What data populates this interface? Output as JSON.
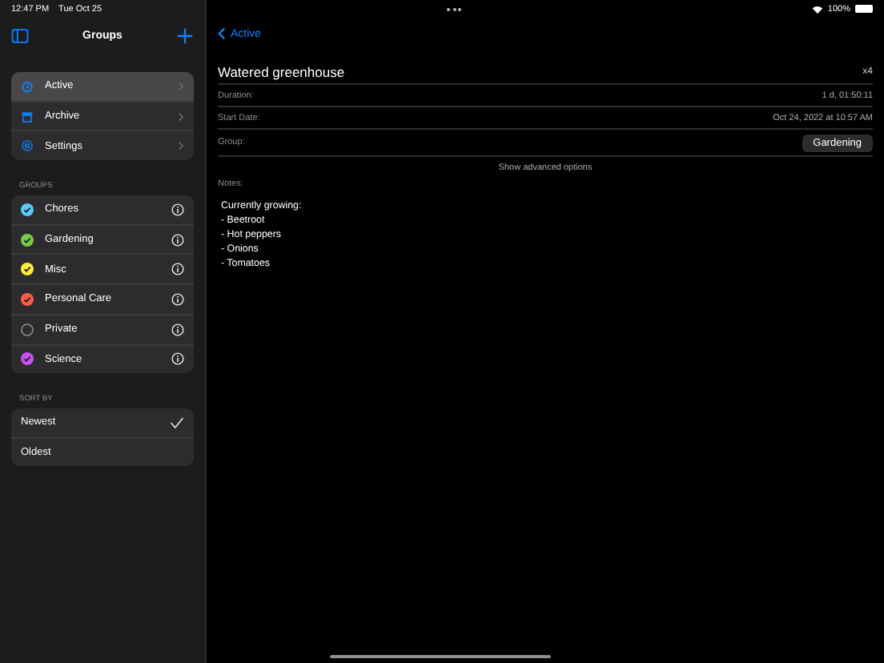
{
  "status_bar": {
    "time": "12:47 PM",
    "date": "Tue Oct 25",
    "battery": "100%"
  },
  "sidebar": {
    "title": "Groups",
    "nav_items": [
      {
        "label": "Active",
        "kind": "timer",
        "selected": true
      },
      {
        "label": "Archive",
        "kind": "archive",
        "selected": false
      },
      {
        "label": "Settings",
        "kind": "settings",
        "selected": false
      }
    ],
    "groups_header": "GROUPS",
    "groups": [
      {
        "label": "Chores",
        "color": "#5ac8fa",
        "checked": true
      },
      {
        "label": "Gardening",
        "color": "#7ac943",
        "checked": true
      },
      {
        "label": "Misc",
        "color": "#ffeb3b",
        "checked": true
      },
      {
        "label": "Personal Care",
        "color": "#ff5a4a",
        "checked": true
      },
      {
        "label": "Private",
        "color": "#8e8e93",
        "checked": false
      },
      {
        "label": "Science",
        "color": "#c552f0",
        "checked": true
      }
    ],
    "sort_header": "SORT BY",
    "sort_options": [
      {
        "label": "Newest",
        "selected": true
      },
      {
        "label": "Oldest",
        "selected": false
      }
    ]
  },
  "detail": {
    "back": "Active",
    "title": "Watered greenhouse",
    "count": "x4",
    "fields": [
      {
        "label": "Duration:",
        "value": "1 d, 01:50:11",
        "kind": "text"
      },
      {
        "label": "Start Date:",
        "value": "Oct 24, 2022 at 10:57 AM",
        "kind": "text"
      },
      {
        "label": "Group:",
        "value": "Gardening",
        "kind": "button"
      }
    ],
    "advanced": "Show advanced options",
    "notes_label": "Notes:",
    "notes": [
      "Currently growing:",
      "- Beetroot",
      "- Hot peppers",
      "- Onions",
      "- Tomatoes"
    ]
  }
}
